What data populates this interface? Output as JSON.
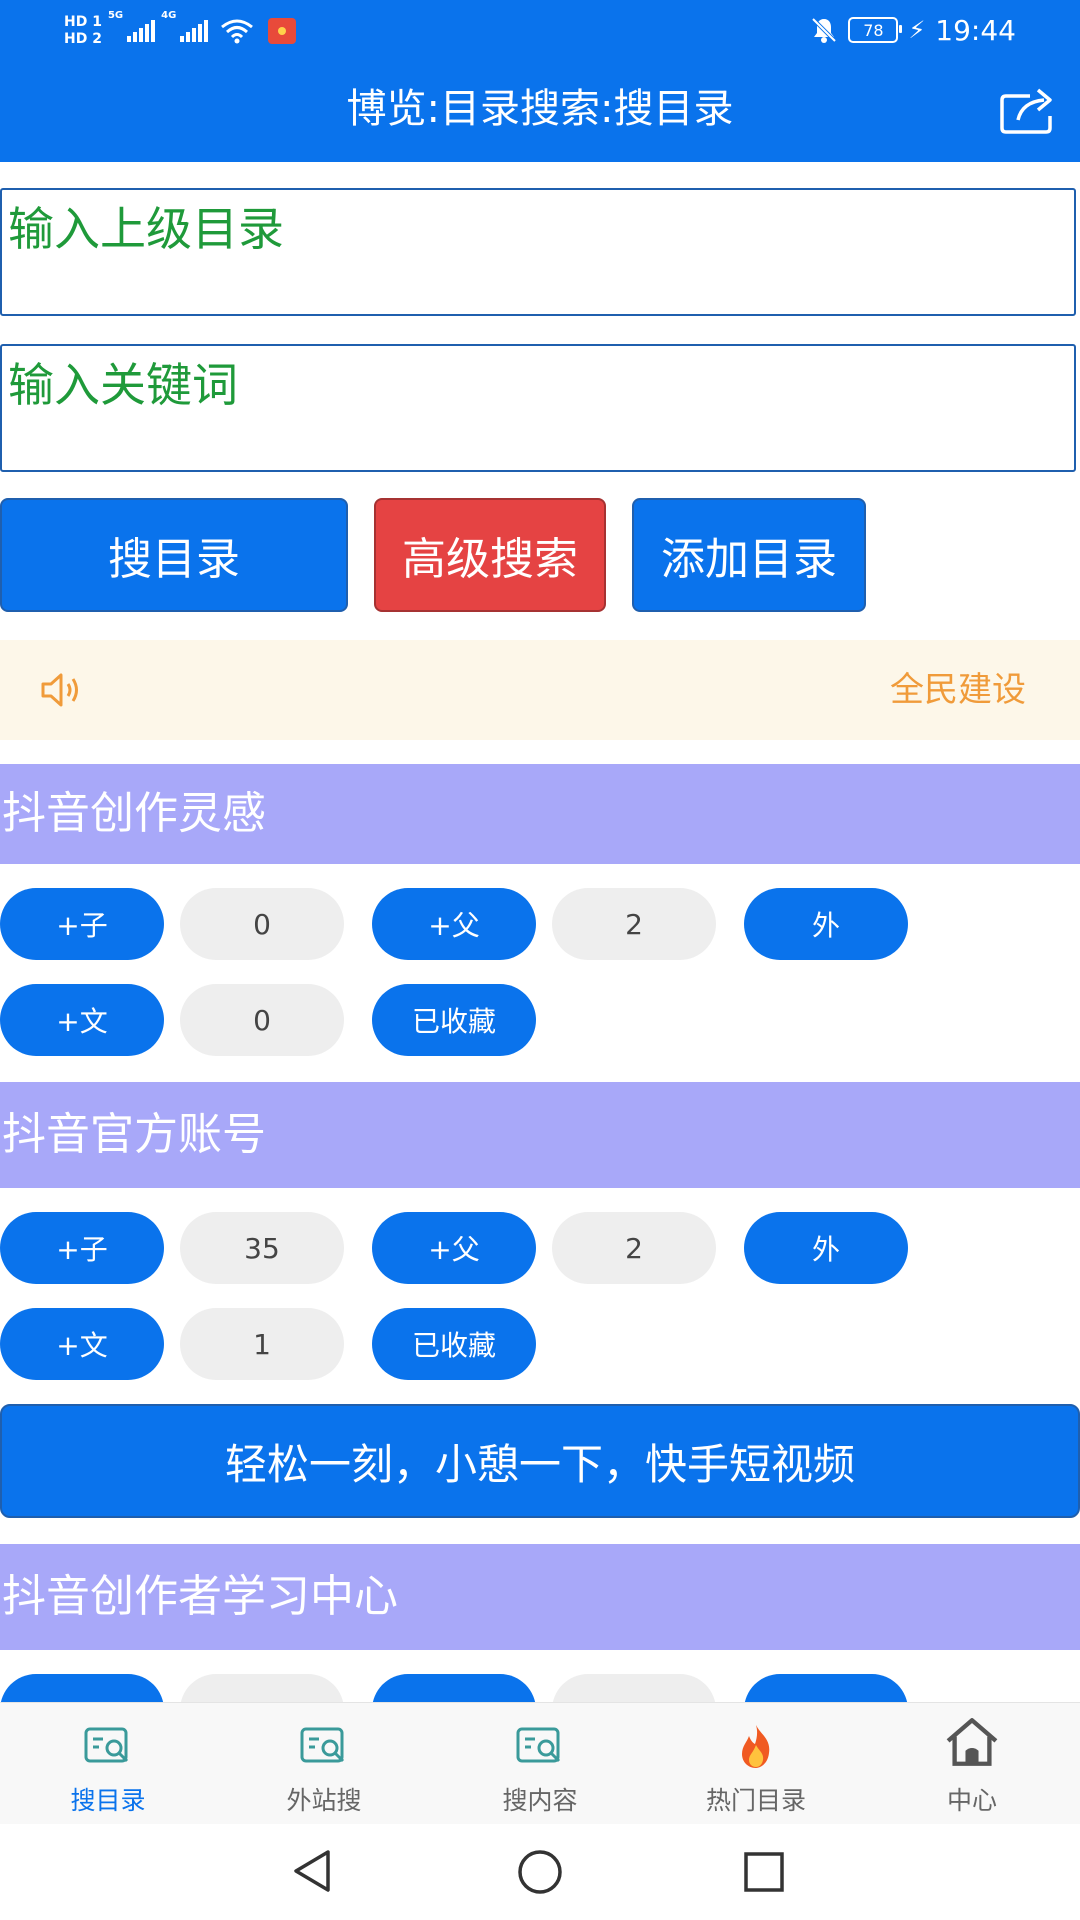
{
  "status_bar": {
    "hd1": "HD 1",
    "hd2": "HD 2",
    "net1": "5G",
    "net2": "4G",
    "battery": "78",
    "time": "19:44"
  },
  "header": {
    "title": "博览:目录搜索:搜目录",
    "share_icon": "share-icon"
  },
  "inputs": {
    "parent_dir_placeholder": "输入上级目录",
    "parent_dir_value": "",
    "keyword_placeholder": "输入关键词",
    "keyword_value": ""
  },
  "buttons": {
    "search_dir": "搜目录",
    "advanced": "高级搜索",
    "add_dir": "添加目录"
  },
  "notice": {
    "icon": "speaker-icon",
    "text": "全民建设"
  },
  "categories": [
    {
      "title": "抖音创作灵感",
      "add_child": "+子",
      "child_count": "0",
      "add_parent": "+父",
      "parent_count": "2",
      "external": "外",
      "add_article": "+文",
      "article_count": "0",
      "favorited": "已收藏"
    },
    {
      "title": "抖音官方账号",
      "add_child": "+子",
      "child_count": "35",
      "add_parent": "+父",
      "parent_count": "2",
      "external": "外",
      "add_article": "+文",
      "article_count": "1",
      "favorited": "已收藏"
    },
    {
      "title": "抖音创作者学习中心"
    }
  ],
  "banner": {
    "text": "轻松一刻，小憩一下，快手短视频"
  },
  "bottom_nav": [
    {
      "label": "搜目录",
      "icon": "search-folder-icon",
      "active": true
    },
    {
      "label": "外站搜",
      "icon": "search-folder-icon",
      "active": false
    },
    {
      "label": "搜内容",
      "icon": "search-folder-icon",
      "active": false
    },
    {
      "label": "热门目录",
      "icon": "fire-icon",
      "active": false
    },
    {
      "label": "中心",
      "icon": "home-icon",
      "active": false
    }
  ],
  "colors": {
    "primary": "#0a73ec",
    "danger": "#e54343",
    "category_bg": "#a8a8f9",
    "placeholder": "#1f9a3a",
    "notice_text": "#f09b3a",
    "notice_bg": "#fdf7e9"
  }
}
